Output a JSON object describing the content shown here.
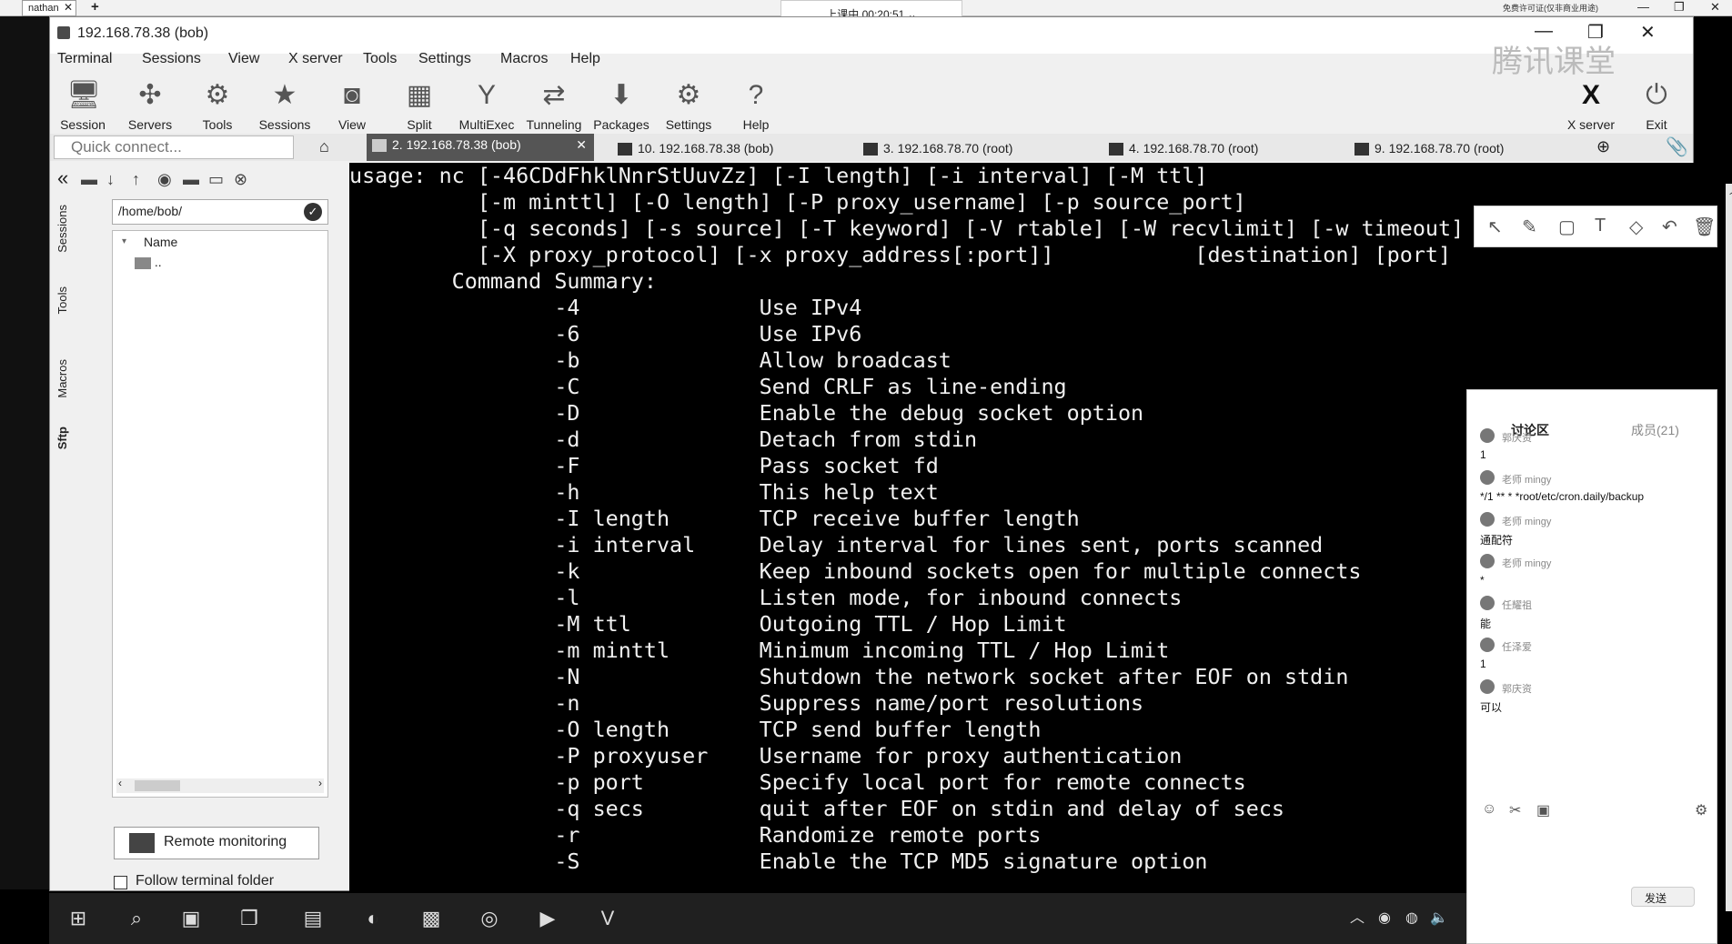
{
  "topbar": {
    "tab_label": "nathan",
    "session_status": "上课中 00:20:51",
    "right_label": "免费许可证(仅非商业用途)"
  },
  "window": {
    "title": "192.168.78.38 (bob)"
  },
  "menu": [
    "Terminal",
    "Sessions",
    "View",
    "X server",
    "Tools",
    "Settings",
    "Macros",
    "Help"
  ],
  "toolbar": [
    {
      "label": "Session",
      "icon": "monitor-icon"
    },
    {
      "label": "Servers",
      "icon": "servers-icon"
    },
    {
      "label": "Tools",
      "icon": "tools-icon"
    },
    {
      "label": "Sessions",
      "icon": "star-icon"
    },
    {
      "label": "View",
      "icon": "view-icon"
    },
    {
      "label": "Split",
      "icon": "split-icon"
    },
    {
      "label": "MultiExec",
      "icon": "multiexec-icon"
    },
    {
      "label": "Tunneling",
      "icon": "tunneling-icon"
    },
    {
      "label": "Packages",
      "icon": "packages-icon"
    },
    {
      "label": "Settings",
      "icon": "settings-icon"
    },
    {
      "label": "Help",
      "icon": "help-icon"
    }
  ],
  "toolbar_right": {
    "xserver": "X server",
    "exit": "Exit"
  },
  "quick_connect_placeholder": "Quick connect...",
  "tabs": [
    {
      "label": "2. 192.168.78.38 (bob)",
      "active": true
    },
    {
      "label": "10. 192.168.78.38 (bob)",
      "active": false
    },
    {
      "label": "3. 192.168.78.70 (root)",
      "active": false
    },
    {
      "label": "4. 192.168.78.70 (root)",
      "active": false
    },
    {
      "label": "9. 192.168.78.70 (root)",
      "active": false
    }
  ],
  "sidebar": {
    "vtabs": [
      "Sessions",
      "Tools",
      "Macros",
      "Sftp"
    ],
    "path": "/home/bob/",
    "column_name": "Name",
    "parent_dir": "..",
    "remote_monitoring": "Remote monitoring",
    "follow_folder": "Follow terminal folder"
  },
  "terminal": {
    "lines": [
      "usage: nc [-46CDdFhklNnrStUuvZz] [-I length] [-i interval] [-M ttl]",
      "          [-m minttl] [-O length] [-P proxy_username] [-p source_port]",
      "          [-q seconds] [-s source] [-T keyword] [-V rtable] [-W recvlimit] [-w timeout]",
      "          [-X proxy_protocol] [-x proxy_address[:port]]           [destination] [port]",
      "        Command Summary:",
      "                -4              Use IPv4",
      "                -6              Use IPv6",
      "                -b              Allow broadcast",
      "                -C              Send CRLF as line-ending",
      "                -D              Enable the debug socket option",
      "                -d              Detach from stdin",
      "                -F              Pass socket fd",
      "                -h              This help text",
      "                -I length       TCP receive buffer length",
      "                -i interval     Delay interval for lines sent, ports scanned",
      "                -k              Keep inbound sockets open for multiple connects",
      "                -l              Listen mode, for inbound connects",
      "                -M ttl          Outgoing TTL / Hop Limit",
      "                -m minttl       Minimum incoming TTL / Hop Limit",
      "                -N              Shutdown the network socket after EOF on stdin",
      "                -n              Suppress name/port resolutions",
      "                -O length       TCP send buffer length",
      "                -P proxyuser    Username for proxy authentication",
      "                -p port         Specify local port for remote connects",
      "                -q secs         quit after EOF on stdin and delay of secs",
      "                -r              Randomize remote ports",
      "                -S              Enable the TCP MD5 signature option"
    ]
  },
  "chat": {
    "tab_discuss": "讨论区",
    "tab_members": "成员(21)",
    "messages": [
      {
        "name": "郭庆资",
        "text": "1"
      },
      {
        "name": "老师 mingy",
        "text": "*/1 ** * *root/etc/cron.daily/backup"
      },
      {
        "name": "老师 mingy",
        "text": "通配符"
      },
      {
        "name": "老师 mingy",
        "text": "*"
      },
      {
        "name": "任耀祖",
        "text": "能"
      },
      {
        "name": "任泽爱",
        "text": "1"
      },
      {
        "name": "郭庆资",
        "text": "可以"
      }
    ],
    "send_label": "发送"
  },
  "watermark": "腾讯课堂",
  "colors": {
    "terminal_bg": "#000000",
    "terminal_fg": "#f0f0f0",
    "active_tab": "#555555"
  }
}
